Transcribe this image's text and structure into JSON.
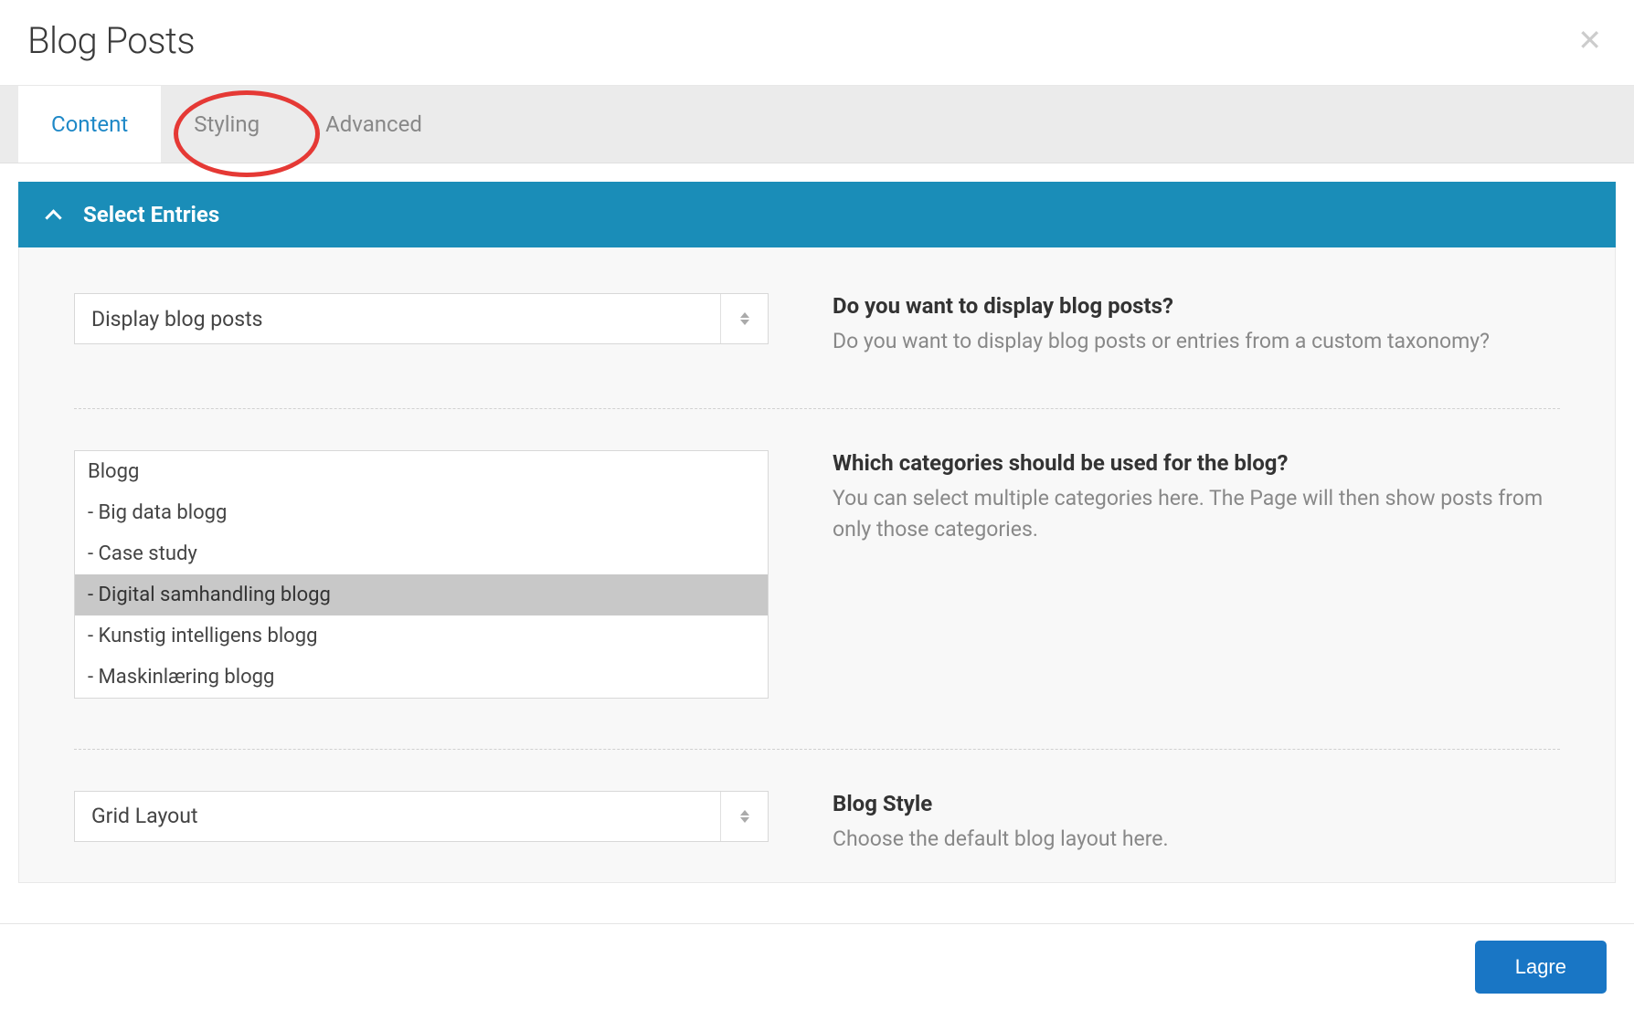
{
  "header": {
    "title": "Blog Posts"
  },
  "tabs": [
    {
      "label": "Content",
      "active": true
    },
    {
      "label": "Styling",
      "active": false,
      "highlighted": true
    },
    {
      "label": "Advanced",
      "active": false
    }
  ],
  "accordion": {
    "title": "Select Entries",
    "expanded": true
  },
  "fields": {
    "display": {
      "value": "Display blog posts",
      "label": "Do you want to display blog posts?",
      "description": "Do you want to display blog posts or entries from a custom taxonomy?"
    },
    "categories": {
      "label": "Which categories should be used for the blog?",
      "description": "You can select multiple categories here. The Page will then show posts from only those categories.",
      "options": [
        {
          "label": "Blogg",
          "selected": false
        },
        {
          "label": " - Big data blogg",
          "selected": false
        },
        {
          "label": " - Case study",
          "selected": false
        },
        {
          "label": "  - Digital samhandling blogg",
          "selected": true
        },
        {
          "label": " - Kunstig intelligens blogg",
          "selected": false
        },
        {
          "label": " - Maskinlæring blogg",
          "selected": false
        }
      ]
    },
    "layout": {
      "value": "Grid Layout",
      "label": "Blog Style",
      "description": "Choose the default blog layout here."
    }
  },
  "footer": {
    "save_label": "Lagre"
  }
}
